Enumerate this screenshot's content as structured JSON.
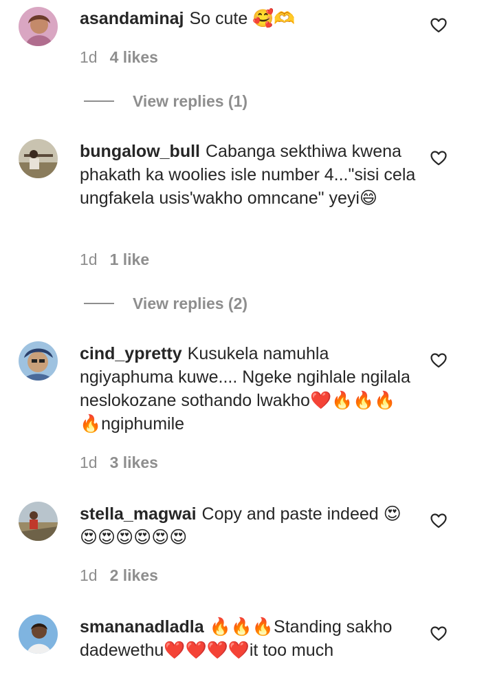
{
  "comments": [
    {
      "username": "asandaminaj",
      "text": "So cute 🥰🫶",
      "age": "1d",
      "likes": "4 likes",
      "replies": "View replies (1)",
      "avatar_color": "#c98aa8"
    },
    {
      "username": "bungalow_bull",
      "text": "Cabanga sekthiwa kwena phakath ka woolies isle number 4...\"sisi cela ungfakela usis'wakho omncane\" yeyi😄",
      "age": "1d",
      "likes": "1 like",
      "replies": "View replies (2)",
      "avatar_color": "#8a8f7a"
    },
    {
      "username": "cind_ypretty",
      "text": "Kusukela namuhla ngiyaphuma kuwe.... Ngeke ngihlale ngilala neslokozane sothando lwakho❤️🔥🔥🔥🔥ngiphumile",
      "age": "1d",
      "likes": "3 likes",
      "avatar_color": "#3d6fa8"
    },
    {
      "username": "stella_magwai",
      "text": "Copy and paste indeed 😍😍😍😍😍😍😍",
      "age": "1d",
      "likes": "2 likes",
      "avatar_color": "#8a7f62"
    },
    {
      "username": "smananadladla",
      "text": "🔥🔥🔥Standing sakho dadewethu❤️❤️❤️❤️it too much",
      "avatar_color": "#5b93c8"
    }
  ],
  "colors": {
    "primary_text": "#262626",
    "secondary_text": "#8e8e8e",
    "background": "#ffffff"
  },
  "icons": {
    "like": "heart-outline-icon"
  }
}
